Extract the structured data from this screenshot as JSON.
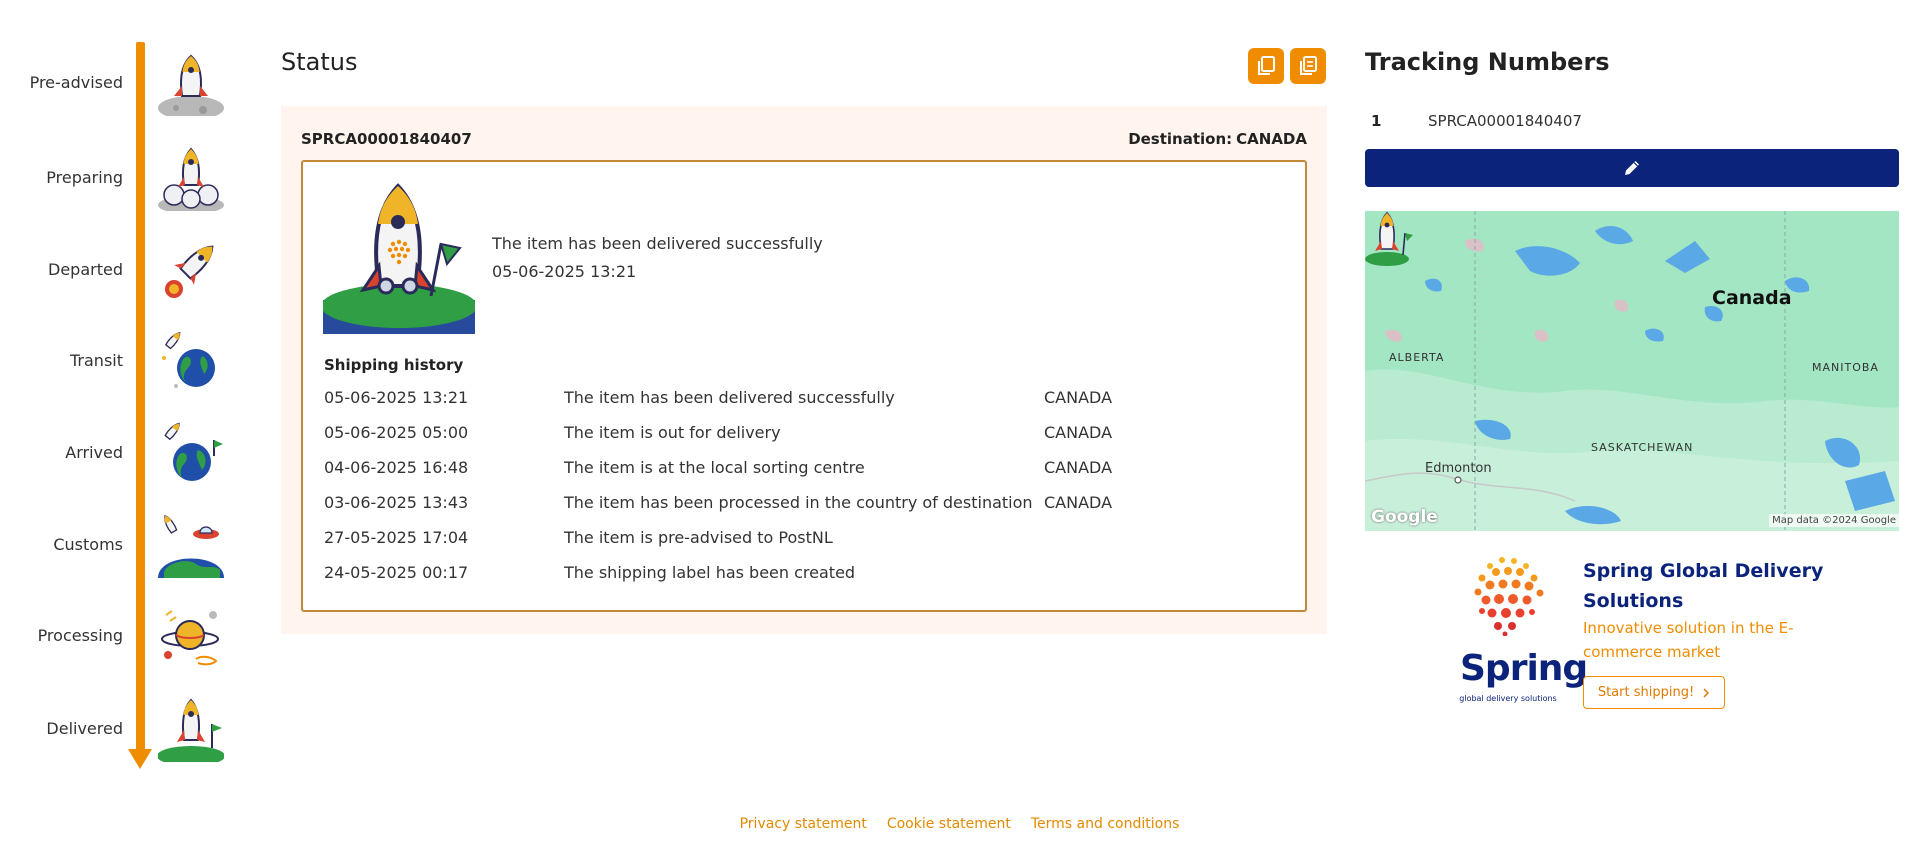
{
  "timeline": {
    "steps": [
      {
        "label": "Pre-advised",
        "icon": "rocket-on-moon-icon"
      },
      {
        "label": "Preparing",
        "icon": "rocket-launching-icon"
      },
      {
        "label": "Departed",
        "icon": "rocket-flying-icon"
      },
      {
        "label": "Transit",
        "icon": "rocket-earth-icon"
      },
      {
        "label": "Arrived",
        "icon": "earth-flag-icon"
      },
      {
        "label": "Customs",
        "icon": "ufo-planet-icon"
      },
      {
        "label": "Processing",
        "icon": "saturn-planet-icon"
      },
      {
        "label": "Delivered",
        "icon": "rocket-landed-icon"
      }
    ],
    "color": "#f08c00"
  },
  "status": {
    "title": "Status",
    "shipment_id": "SPRCA00001840407",
    "destination_label": "Destination:",
    "destination": "CANADA",
    "current_status": "The item has been delivered successfully",
    "current_date": "05-06-2025 13:21",
    "history_title": "Shipping history",
    "history": [
      {
        "date": "05-06-2025 13:21",
        "description": "The item has been delivered successfully",
        "location": "CANADA"
      },
      {
        "date": "05-06-2025 05:00",
        "description": "The item is out for delivery",
        "location": "CANADA"
      },
      {
        "date": "04-06-2025 16:48",
        "description": "The item is at the local sorting centre",
        "location": "CANADA"
      },
      {
        "date": "03-06-2025 13:43",
        "description": "The item has been processed in the country of destination",
        "location": "CANADA"
      },
      {
        "date": "27-05-2025 17:04",
        "description": "The item is pre-advised to PostNL",
        "location": ""
      },
      {
        "date": "24-05-2025 00:17",
        "description": "The shipping label has been created",
        "location": ""
      }
    ]
  },
  "tracking": {
    "title": "Tracking Numbers",
    "items": [
      {
        "number": "1",
        "code": "SPRCA00001840407"
      }
    ]
  },
  "map": {
    "country": "Canada",
    "regions": [
      "ALBERTA",
      "MANITOBA",
      "SASKATCHEWAN"
    ],
    "city": "Edmonton",
    "logo": "Google",
    "attribution": "Map data ©2024 Google"
  },
  "promo": {
    "brand": "Spring",
    "tagline": "global delivery solutions",
    "title": "Spring Global Delivery Solutions",
    "description": "Innovative solution in the E-commerce market",
    "button": "Start shipping!",
    "button_icon": "chevron-right-icon"
  },
  "footer": {
    "links": [
      "Privacy statement",
      "Cookie statement",
      "Terms and conditions"
    ]
  },
  "colors": {
    "accent": "#f08c00",
    "navy": "#0b237b",
    "panel_bg": "#fff5ee",
    "box_border": "#c08a3a"
  }
}
